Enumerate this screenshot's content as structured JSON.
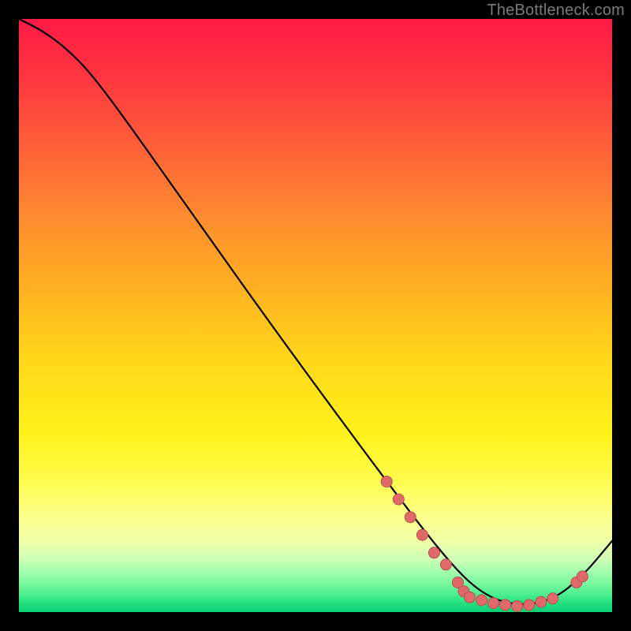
{
  "attribution": "TheBottleneck.com",
  "colors": {
    "page_bg": "#000000",
    "curve": "#000000",
    "dot_fill": "#e06a6a",
    "dot_stroke": "#b84f4f",
    "gradient_top": "#ff1a45",
    "gradient_bottom": "#0ad076"
  },
  "chart_data": {
    "type": "line",
    "title": "",
    "xlabel": "",
    "ylabel": "",
    "xlim": [
      0,
      100
    ],
    "ylim": [
      0,
      100
    ],
    "series": [
      {
        "name": "curve",
        "x": [
          0,
          4,
          8,
          12,
          18,
          30,
          45,
          62,
          72,
          78,
          84,
          90,
          95,
          100
        ],
        "y": [
          100,
          98,
          95,
          91,
          83,
          66,
          45,
          22,
          9,
          3,
          1,
          2,
          6,
          12
        ]
      }
    ],
    "points": [
      {
        "x": 62,
        "y": 22
      },
      {
        "x": 64,
        "y": 19
      },
      {
        "x": 66,
        "y": 16
      },
      {
        "x": 68,
        "y": 13
      },
      {
        "x": 70,
        "y": 10
      },
      {
        "x": 72,
        "y": 8
      },
      {
        "x": 74,
        "y": 5
      },
      {
        "x": 75,
        "y": 3.5
      },
      {
        "x": 76,
        "y": 2.5
      },
      {
        "x": 78,
        "y": 2
      },
      {
        "x": 80,
        "y": 1.5
      },
      {
        "x": 82,
        "y": 1.2
      },
      {
        "x": 84,
        "y": 1
      },
      {
        "x": 86,
        "y": 1.2
      },
      {
        "x": 88,
        "y": 1.7
      },
      {
        "x": 90,
        "y": 2.3
      },
      {
        "x": 94,
        "y": 5
      },
      {
        "x": 95,
        "y": 6
      }
    ]
  }
}
